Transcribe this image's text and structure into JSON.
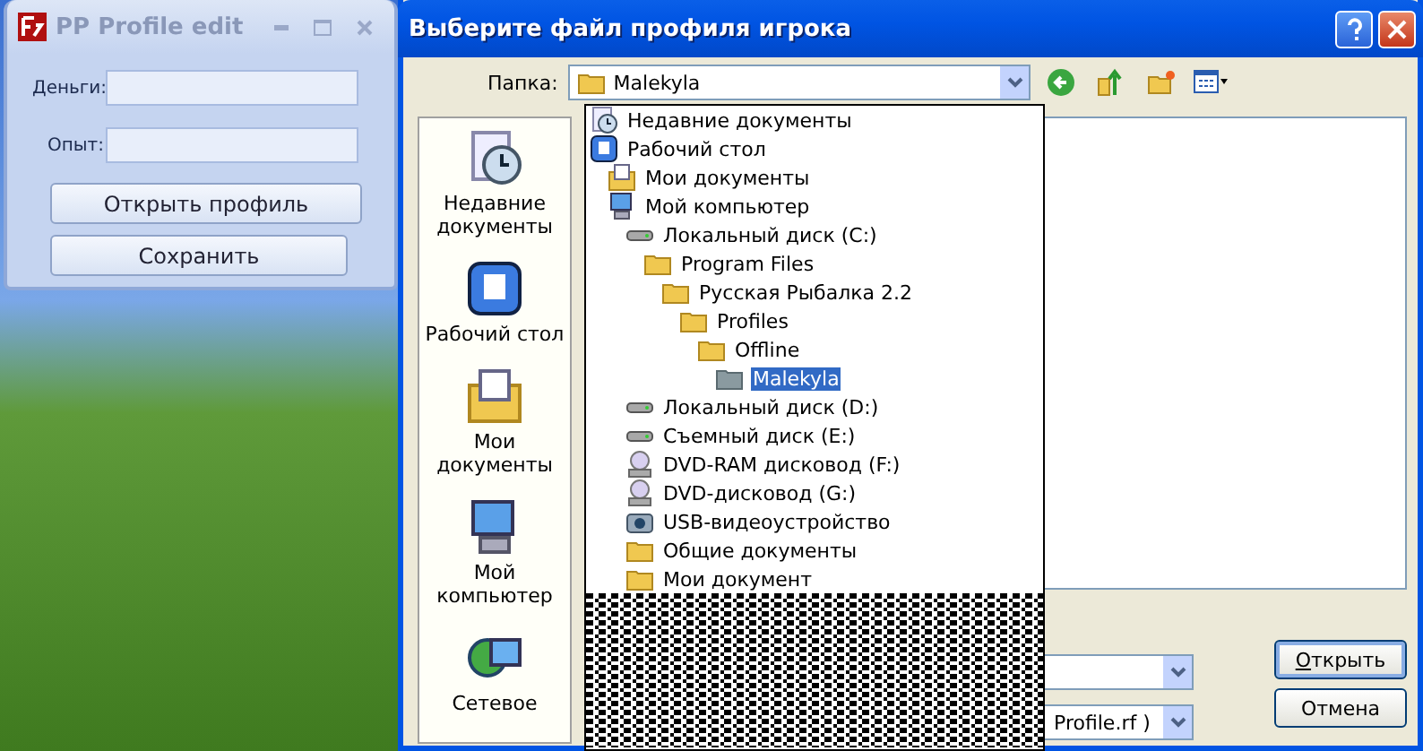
{
  "app_window": {
    "title": "PP Profile edit",
    "fields": [
      {
        "label": "Деньги:"
      },
      {
        "label": "Опыт:"
      }
    ],
    "buttons": [
      "Открыть профиль",
      "Сохранить"
    ]
  },
  "dialog": {
    "title": "Выберите файл профиля игрока",
    "folder_label": "Папка:",
    "folder_value": "Malekyla",
    "places": [
      {
        "label": "Недавние документы",
        "kind": "recent"
      },
      {
        "label": "Рабочий стол",
        "kind": "desktop"
      },
      {
        "label": "Мои документы",
        "kind": "docs"
      },
      {
        "label": "Мой компьютер",
        "kind": "computer"
      },
      {
        "label": "Сетевое",
        "kind": "network"
      }
    ],
    "folder_tree": [
      {
        "label": "Недавние документы",
        "kind": "recent",
        "selected": false
      },
      {
        "label": "Рабочий стол",
        "kind": "desktop",
        "selected": false,
        "children": [
          {
            "label": "Мои документы",
            "kind": "docs",
            "selected": false
          },
          {
            "label": "Мой компьютер",
            "kind": "computer",
            "selected": false,
            "children": [
              {
                "label": "Локальный диск (C:)",
                "kind": "drive",
                "selected": false,
                "children": [
                  {
                    "label": "Program Files",
                    "kind": "folder",
                    "selected": false,
                    "children": [
                      {
                        "label": "Русская Рыбалка 2.2",
                        "kind": "folder",
                        "selected": false,
                        "children": [
                          {
                            "label": "Profiles",
                            "kind": "folder",
                            "selected": false,
                            "children": [
                              {
                                "label": "Offline",
                                "kind": "folder",
                                "selected": false,
                                "children": [
                                  {
                                    "label": "Malekyla",
                                    "kind": "folder",
                                    "selected": true
                                  }
                                ]
                              }
                            ]
                          }
                        ]
                      }
                    ]
                  }
                ]
              },
              {
                "label": "Локальный диск (D:)",
                "kind": "drive",
                "selected": false
              },
              {
                "label": "Съемный диск (E:)",
                "kind": "drive",
                "selected": false
              },
              {
                "label": "DVD-RAM дисковод (F:)",
                "kind": "cdrom",
                "selected": false
              },
              {
                "label": "DVD-дисковод (G:)",
                "kind": "cdrom",
                "selected": false
              },
              {
                "label": "USB-видеоустройство",
                "kind": "camera",
                "selected": false
              },
              {
                "label": "Общие документы",
                "kind": "folder",
                "selected": false
              },
              {
                "label": "Мои документ",
                "kind": "folder",
                "selected": false
              }
            ]
          }
        ]
      }
    ],
    "file_type_value": "Profile.rf )",
    "buttons": [
      {
        "label": "Открыть",
        "underline_first": true,
        "default": true
      },
      {
        "label": "Отмена",
        "underline_first": false,
        "default": false
      }
    ]
  }
}
